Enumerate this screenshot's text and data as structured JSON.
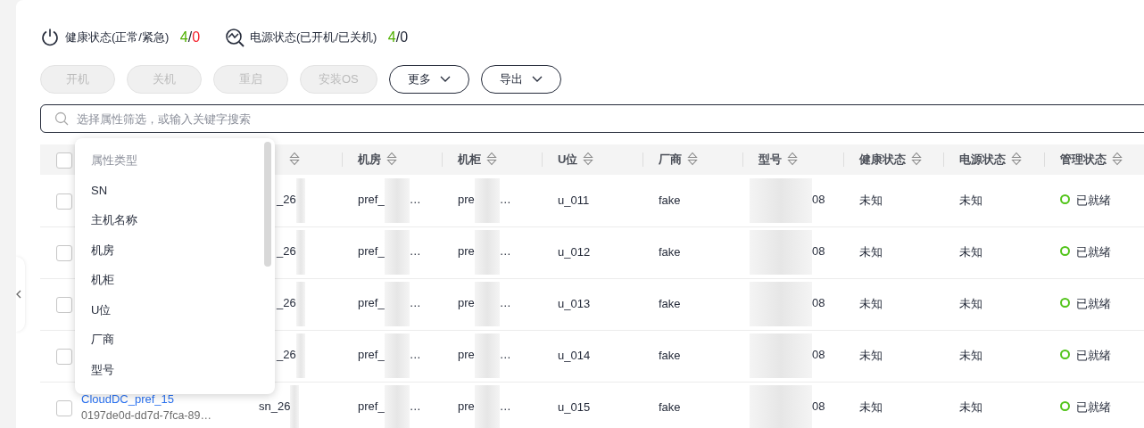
{
  "stats": [
    {
      "label": "健康状态(正常/紧急)",
      "parts": [
        {
          "text": "4",
          "kind": "normal"
        },
        {
          "text": "/",
          "kind": "plain"
        },
        {
          "text": "0",
          "kind": "alert"
        }
      ]
    },
    {
      "label": "电源状态(已开机/已关机)",
      "parts": [
        {
          "text": "4",
          "kind": "normal"
        },
        {
          "text": "/0",
          "kind": "plain"
        }
      ]
    }
  ],
  "buttons": [
    {
      "label": "开机",
      "disabled": true,
      "dropdown": false
    },
    {
      "label": "关机",
      "disabled": true,
      "dropdown": false
    },
    {
      "label": "重启",
      "disabled": true,
      "dropdown": false
    },
    {
      "label": "安装OS",
      "disabled": true,
      "dropdown": false
    },
    {
      "label": "更多",
      "disabled": false,
      "dropdown": true
    },
    {
      "label": "导出",
      "disabled": false,
      "dropdown": true
    }
  ],
  "search": {
    "placeholder": "选择属性筛选，或输入关键字搜索"
  },
  "table": {
    "select_all": {
      "checked": false
    },
    "columns": [
      "机房",
      "机柜",
      "U位",
      "厂商",
      "型号",
      "健康状态",
      "电源状态",
      "管理状态"
    ],
    "rows": [
      {
        "checked": false,
        "sn": "_26",
        "room": {
          "before": "pref_",
          "after": "…"
        },
        "rack": {
          "before": "pre",
          "after": "…"
        },
        "u": "u_011",
        "vendor": "fake",
        "model": {
          "after": "08"
        },
        "health": "未知",
        "power": "未知",
        "admin": {
          "text": "已就绪",
          "color": "#52c41a"
        }
      },
      {
        "checked": false,
        "sn": "_26",
        "room": {
          "before": "pref_",
          "after": "…"
        },
        "rack": {
          "before": "pre",
          "after": "…"
        },
        "u": "u_012",
        "vendor": "fake",
        "model": {
          "after": "08"
        },
        "health": "未知",
        "power": "未知",
        "admin": {
          "text": "已就绪",
          "color": "#52c41a"
        }
      },
      {
        "checked": false,
        "sn": "_26",
        "room": {
          "before": "pref_",
          "after": "…"
        },
        "rack": {
          "before": "pre",
          "after": "…"
        },
        "u": "u_013",
        "vendor": "fake",
        "model": {
          "after": "08"
        },
        "health": "未知",
        "power": "未知",
        "admin": {
          "text": "已就绪",
          "color": "#52c41a"
        }
      },
      {
        "checked": false,
        "sn": "_26",
        "room": {
          "before": "pref_",
          "after": "…"
        },
        "rack": {
          "before": "pre",
          "after": "…"
        },
        "u": "u_014",
        "vendor": "fake",
        "model": {
          "after": "08"
        },
        "health": "未知",
        "power": "未知",
        "admin": {
          "text": "已就绪",
          "color": "#52c41a"
        }
      },
      {
        "checked": false,
        "host": "CloudDC_pref_15",
        "host_id": "0197de0d-dd7d-7fca-89…",
        "sn": "sn_26",
        "room": {
          "before": "pref_",
          "after": "…"
        },
        "rack": {
          "before": "pre",
          "after": "…"
        },
        "u": "u_015",
        "vendor": "fake",
        "model": {
          "after": "08"
        },
        "health": "未知",
        "power": "未知",
        "admin": {
          "text": "已就绪",
          "color": "#52c41a"
        }
      }
    ]
  },
  "dropdown": {
    "title": "属性类型",
    "items": [
      "SN",
      "主机名称",
      "机房",
      "机柜",
      "U位",
      "厂商",
      "型号"
    ]
  }
}
